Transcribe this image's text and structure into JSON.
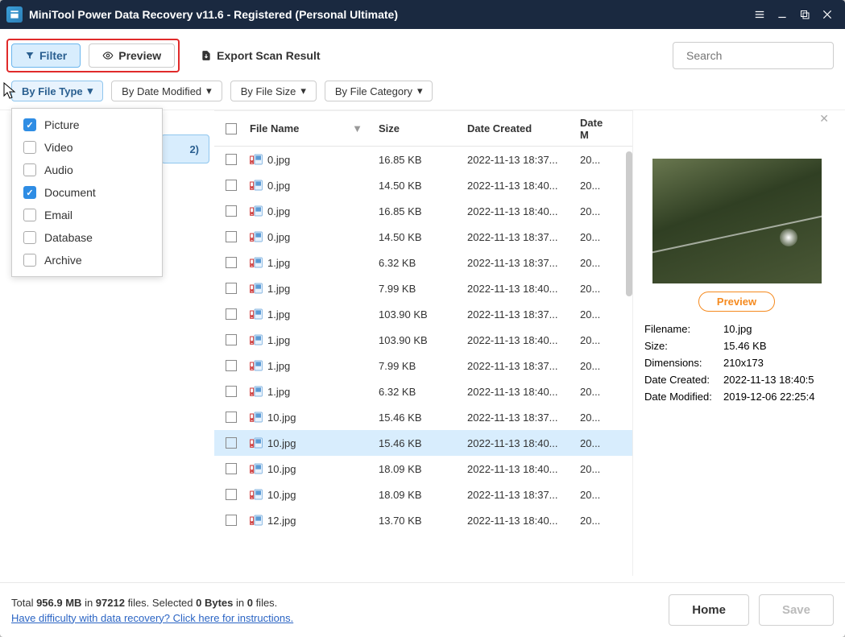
{
  "window": {
    "title": "MiniTool Power Data Recovery v11.6 - Registered (Personal Ultimate)"
  },
  "toolbar": {
    "filter": "Filter",
    "preview": "Preview",
    "export": "Export Scan Result",
    "search_placeholder": "Search"
  },
  "filters": {
    "by_type": "By File Type",
    "by_date": "By Date Modified",
    "by_size": "By File Size",
    "by_category": "By File Category"
  },
  "type_options": [
    {
      "label": "Picture",
      "checked": true
    },
    {
      "label": "Video",
      "checked": false
    },
    {
      "label": "Audio",
      "checked": false
    },
    {
      "label": "Document",
      "checked": true
    },
    {
      "label": "Email",
      "checked": false
    },
    {
      "label": "Database",
      "checked": false
    },
    {
      "label": "Archive",
      "checked": false
    }
  ],
  "tab_count": "2)",
  "columns": {
    "name": "File Name",
    "size": "Size",
    "created": "Date Created",
    "modified": "Date M"
  },
  "rows": [
    {
      "name": "0.jpg",
      "size": "16.85 KB",
      "created": "2022-11-13 18:37...",
      "mod": "20...",
      "sel": false
    },
    {
      "name": "0.jpg",
      "size": "14.50 KB",
      "created": "2022-11-13 18:40...",
      "mod": "20...",
      "sel": false
    },
    {
      "name": "0.jpg",
      "size": "16.85 KB",
      "created": "2022-11-13 18:40...",
      "mod": "20...",
      "sel": false
    },
    {
      "name": "0.jpg",
      "size": "14.50 KB",
      "created": "2022-11-13 18:37...",
      "mod": "20...",
      "sel": false
    },
    {
      "name": "1.jpg",
      "size": "6.32 KB",
      "created": "2022-11-13 18:37...",
      "mod": "20...",
      "sel": false
    },
    {
      "name": "1.jpg",
      "size": "7.99 KB",
      "created": "2022-11-13 18:40...",
      "mod": "20...",
      "sel": false
    },
    {
      "name": "1.jpg",
      "size": "103.90 KB",
      "created": "2022-11-13 18:37...",
      "mod": "20...",
      "sel": false
    },
    {
      "name": "1.jpg",
      "size": "103.90 KB",
      "created": "2022-11-13 18:40...",
      "mod": "20...",
      "sel": false
    },
    {
      "name": "1.jpg",
      "size": "7.99 KB",
      "created": "2022-11-13 18:37...",
      "mod": "20...",
      "sel": false
    },
    {
      "name": "1.jpg",
      "size": "6.32 KB",
      "created": "2022-11-13 18:40...",
      "mod": "20...",
      "sel": false
    },
    {
      "name": "10.jpg",
      "size": "15.46 KB",
      "created": "2022-11-13 18:37...",
      "mod": "20...",
      "sel": false
    },
    {
      "name": "10.jpg",
      "size": "15.46 KB",
      "created": "2022-11-13 18:40...",
      "mod": "20...",
      "sel": true
    },
    {
      "name": "10.jpg",
      "size": "18.09 KB",
      "created": "2022-11-13 18:40...",
      "mod": "20...",
      "sel": false
    },
    {
      "name": "10.jpg",
      "size": "18.09 KB",
      "created": "2022-11-13 18:37...",
      "mod": "20...",
      "sel": false
    },
    {
      "name": "12.jpg",
      "size": "13.70 KB",
      "created": "2022-11-13 18:40...",
      "mod": "20...",
      "sel": false
    }
  ],
  "preview": {
    "button": "Preview",
    "filename_k": "Filename:",
    "filename_v": "10.jpg",
    "size_k": "Size:",
    "size_v": "15.46 KB",
    "dim_k": "Dimensions:",
    "dim_v": "210x173",
    "created_k": "Date Created:",
    "created_v": "2022-11-13 18:40:5",
    "modified_k": "Date Modified:",
    "modified_v": "2019-12-06 22:25:4"
  },
  "footer": {
    "total_pre": "Total ",
    "total_size": "956.9 MB",
    "in": " in ",
    "total_files": "97212",
    "files": " files. ",
    "sel_pre": "Selected ",
    "sel_bytes": "0 Bytes",
    "in2": " in ",
    "sel_files": "0",
    "files2": " files.",
    "link": "Have difficulty with data recovery? Click here for instructions.",
    "home": "Home",
    "save": "Save"
  }
}
